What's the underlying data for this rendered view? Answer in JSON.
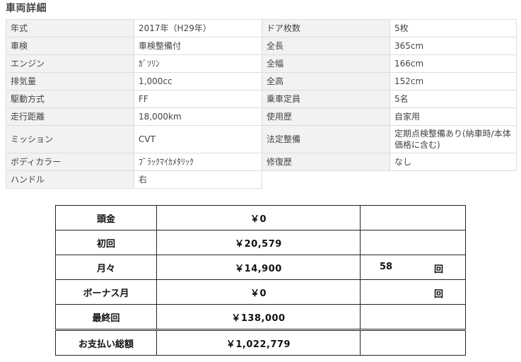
{
  "title": "車両詳細",
  "specs": [
    {
      "l1": "年式",
      "v1": "2017年（H29年）",
      "l2": "ドア枚数",
      "v2": "5枚"
    },
    {
      "l1": "車検",
      "v1": "車検整備付",
      "l2": "全長",
      "v2": "365cm"
    },
    {
      "l1": "エンジン",
      "v1": "ｶﾞｿﾘﾝ",
      "l2": "全幅",
      "v2": "166cm"
    },
    {
      "l1": "排気量",
      "v1": "1,000cc",
      "l2": "全高",
      "v2": "152cm"
    },
    {
      "l1": "駆動方式",
      "v1": "FF",
      "l2": "乗車定員",
      "v2": "5名"
    },
    {
      "l1": "走行距離",
      "v1": "18,000km",
      "l2": "使用歴",
      "v2": "自家用"
    },
    {
      "l1": "ミッション",
      "v1": "CVT",
      "l2": "法定整備",
      "v2": "定期点検整備あり(納車時/本体価格に含む)"
    },
    {
      "l1": "ボディカラー",
      "v1": "ﾌﾞﾗｯｸﾏｲｶﾒﾀﾘｯｸ",
      "l2": "修復歴",
      "v2": "なし"
    },
    {
      "l1": "ハンドル",
      "v1": "右"
    }
  ],
  "payment": {
    "rows": [
      {
        "label": "頭金",
        "value": "￥0",
        "count": "",
        "unit": ""
      },
      {
        "label": "初回",
        "value": "￥20,579",
        "count": "",
        "unit": ""
      },
      {
        "label": "月々",
        "value": "￥14,900",
        "count": "58",
        "unit": "回"
      },
      {
        "label": "ボーナス月",
        "value": "￥0",
        "count": "",
        "unit": "回"
      },
      {
        "label": "最終回",
        "value": "￥138,000",
        "count": "",
        "unit": ""
      },
      {
        "label": "お支払い総額",
        "value": "￥1,022,779",
        "count": "",
        "unit": ""
      }
    ]
  }
}
